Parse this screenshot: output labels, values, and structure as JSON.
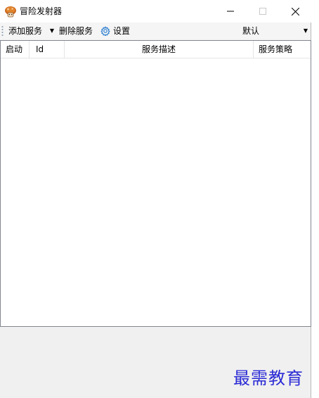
{
  "window": {
    "title": "冒险发射器",
    "app_icon": "mushroom-icon"
  },
  "titlebar_buttons": {
    "minimize": "minimize-icon",
    "maximize": "maximize-icon",
    "close": "close-icon"
  },
  "toolbar": {
    "add_label": "添加服务",
    "delete_label": "删除服务",
    "settings_label": "设置",
    "settings_icon": "gear-icon",
    "dropdown_value": "默认"
  },
  "list": {
    "columns": [
      "启动",
      "Id",
      "服务描述",
      "服务策略"
    ],
    "rows": []
  },
  "watermark": {
    "text": "最需教育"
  },
  "colors": {
    "window_bg": "#f0f0f0",
    "list_bg": "#ffffff",
    "list_border": "#828790",
    "settings_icon": "#2f7fd1",
    "watermark": "#2b2bd6"
  }
}
